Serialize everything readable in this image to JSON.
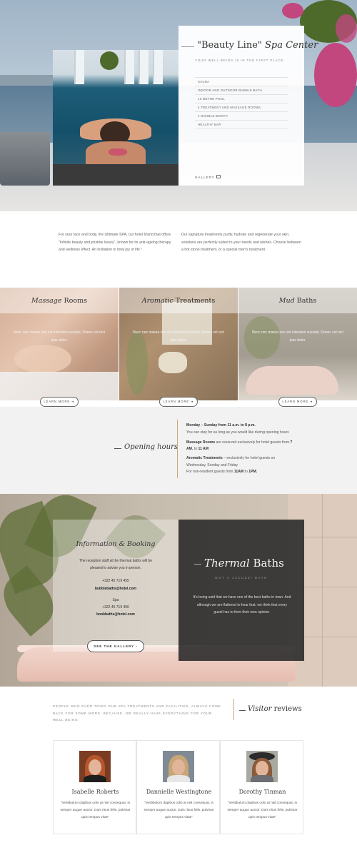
{
  "hero": {
    "title_quoted": "\"Beauty Line\"",
    "title_italic": "Spa Center",
    "subtitle": "YOUR WELL BEING IS IN THE FIRST PLACE.",
    "amenities": [
      "SAUNA",
      "INDOOR AND OUTDOOR BUBBLE BATH",
      "15 METRE POOL",
      "4 TREATMENT AND MASSAGE ROOMS,",
      "1 DOUBLE BOOTH",
      "HEALTHY BAR"
    ],
    "gallery_label": "GALLERY",
    "gallery_icon": "camera-icon"
  },
  "intro": {
    "left": "For your face and body, the Ultimate SPA, our hotel brand that offers \"Infinite beauty and pristine luxury\", known for its anti-ageing therapy and wellness effect.  An invitation to total joy of life !",
    "right": "Our signature treatments purify, hydrate and regenerate your skin, solutions are perfectly suited to your needs and wishes. Choose between  a hot stone treatment, or a special men's treatment."
  },
  "services": [
    {
      "title_italic": "Massage",
      "title_rest": " Rooms",
      "text": "Nunc nec massa nec est interdum suscipit. Donec vel orci quis dolor.",
      "button": "LEARN MORE",
      "button_icon": "arrow-right-icon"
    },
    {
      "title_italic": "Aromatic",
      "title_rest": " Treatments",
      "text": "Nunc nec massa nec est interdum suscipit. Donec vel orci quis dolor.",
      "button": "LEARN MORE",
      "button_icon": "arrow-right-icon"
    },
    {
      "title_italic": "Mud",
      "title_rest": " Baths",
      "text": "Nunc nec massa nec est interdum suscipit. Donec vel orci quis dolor.",
      "button": "LEARN MORE",
      "button_icon": "arrow-right-icon"
    }
  ],
  "hours": {
    "title": "Opening hours",
    "line1_bold": "Monday – Sunday from 11 a.m. to 8 p.m.",
    "line2": "You can stay for as long as you would like during opening hours",
    "line3_bold": "Massage Rooms",
    "line3_rest": " are reserved exclusively for hotel guests from ",
    "line3_bold2": "7",
    "line4_bold": "AM.",
    "line4_mid": " to ",
    "line4_bold2": "11 AM",
    "line5_bold": "Aromatic Treatments",
    "line5_rest": " – exclusively for hotel guests on",
    "line6": "Wednesday, Sunday and Friday",
    "line7_start": "For non-resident guests from ",
    "line7_bold": "11AM",
    "line7_mid": "  to ",
    "line7_bold2": "1PM."
  },
  "info": {
    "title": "Information & Booking",
    "line1": "The reception staff at the thermal baths will be",
    "line2": "pleased to advise you in person.",
    "phone1": "+322 45 719 455",
    "email1": "bubblebaths@hotel.com",
    "spa_label": "Spa",
    "phone2": "+322 45 719 456",
    "email2": "bookbaths@hotel.com",
    "button": "SEE THE GALLERY",
    "button_icon": "chevron-right-icon"
  },
  "thermal": {
    "title_italic": "Thermal",
    "title_rest": " Baths",
    "subtitle": "NOT A JACUZZI BATH",
    "text": "It's being said that we have one of the best baths in town. And although we are flattered to hear that, we think that every guest has to form their own opinion."
  },
  "reviews": {
    "intro": "PEOPLE WHO EVER TRIED OUR SPA TREATMENTS AND FACILITIES, ALWAYS COME BACK FOR SOME MORE. BECAUSE, WE REALLY HAVE EVERYTHING FOR YOUR WELL BEING.",
    "title_italic": "Visitor",
    "title_rest": " reviews",
    "items": [
      {
        "name": "Isabelle Roberts",
        "quote": "\"Vestibulum dapibus odio at nisl consequat, in semper augue auctor. Duis risus felis, pulvinar quis tempus vitae\""
      },
      {
        "name": "Dannielle Westingtone",
        "quote": "\"Vestibulum dapibus odio at nisl consequat, in semper augue auctor. Duis risus felis, pulvinar quis tempus vitae\""
      },
      {
        "name": "Dorothy Tinman",
        "quote": "\"Vestibulum dapibus odio at nisl consequat, in semper augue auctor. Duis risus felis, pulvinar quis tempus vitae\""
      }
    ]
  },
  "colors": {
    "accent_gold": "#c8a777",
    "dark_card": "#2a2a2a",
    "text": "#555555"
  }
}
